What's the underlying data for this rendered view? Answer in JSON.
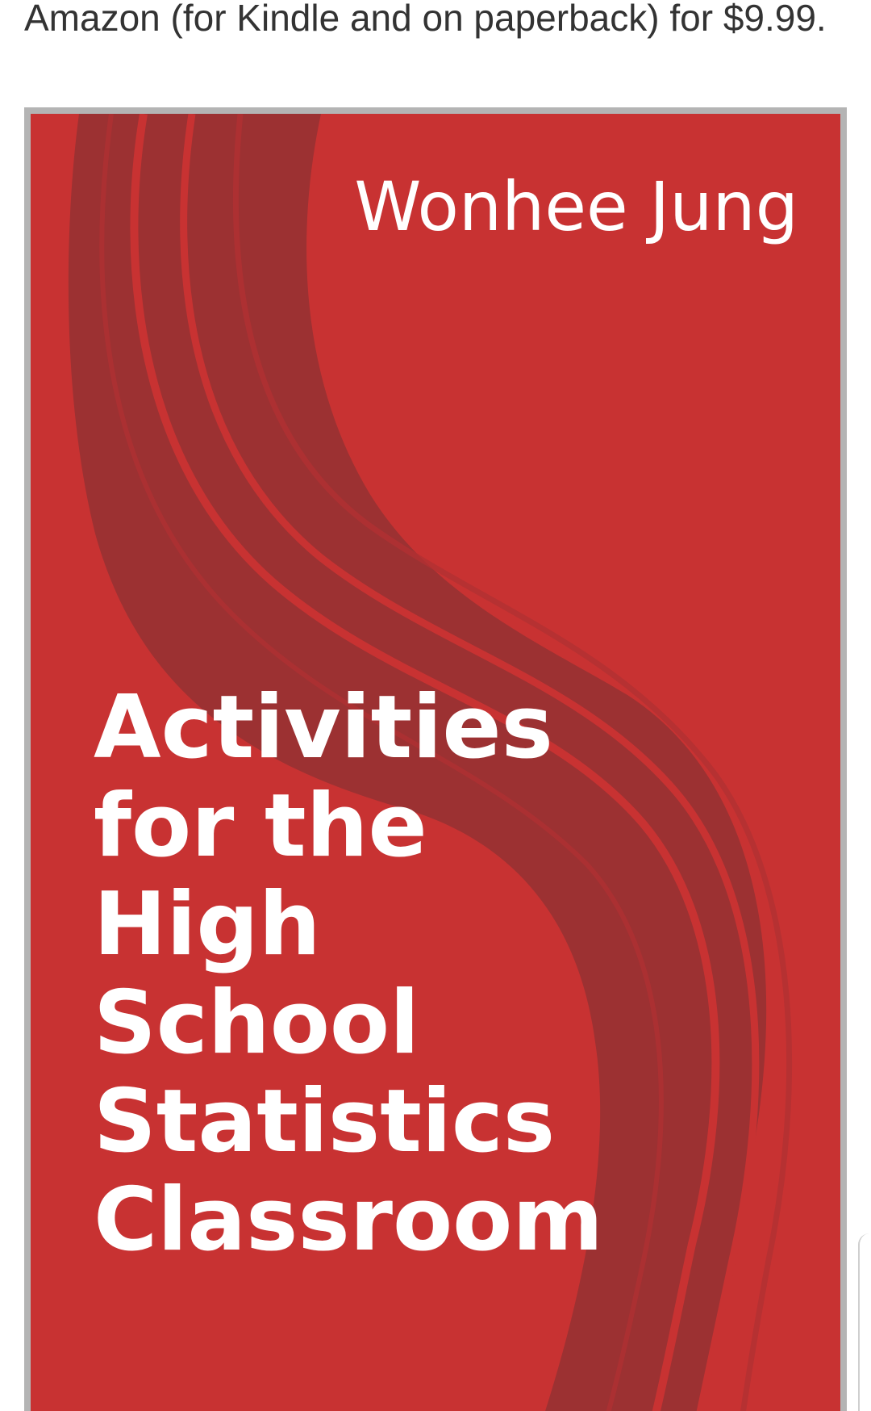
{
  "article": {
    "caption": "Amazon (for Kindle and on paperback) for $9.99."
  },
  "book_cover": {
    "author": "Wonhee Jung",
    "title_lines": [
      "Activities",
      "for the",
      "High",
      "School",
      "Statistics",
      "Classroom"
    ],
    "colors": {
      "background": "#c83232",
      "swoosh": "#9c3132",
      "text": "#ffffff",
      "frame": "#b4b4b4"
    }
  }
}
